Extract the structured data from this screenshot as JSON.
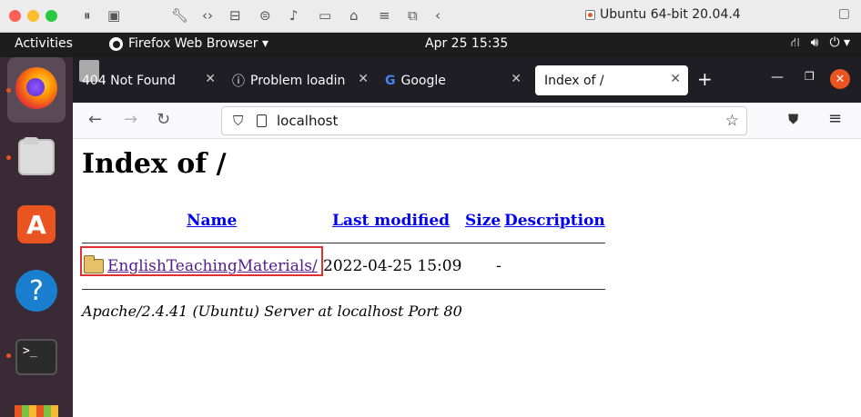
{
  "host": {
    "vm_title": "Ubuntu 64-bit 20.04.4"
  },
  "panel": {
    "activities": "Activities",
    "app_menu": "Firefox Web Browser ▾",
    "clock": "Apr 25  15:35",
    "tray": [
      "network-icon",
      "volume-icon",
      "power-icon"
    ]
  },
  "dock": {
    "items": [
      "firefox",
      "files",
      "ubuntu-software",
      "help",
      "terminal",
      "show-applications"
    ],
    "accent": "#e95420"
  },
  "browser": {
    "tabs": [
      {
        "label": "404 Not Found"
      },
      {
        "label": "Problem loadin"
      },
      {
        "label": "Google"
      },
      {
        "label": "Index of /",
        "active": true
      }
    ],
    "url": "localhost"
  },
  "page": {
    "title": "Index of /",
    "columns": {
      "name": "Name",
      "last_modified": "Last modified",
      "size": "Size",
      "description": "Description"
    },
    "rows": [
      {
        "name": "EnglishTeachingMaterials/",
        "modified": "2022-04-25 15:09",
        "size": "-",
        "description": ""
      }
    ],
    "footer": "Apache/2.4.41 (Ubuntu) Server at localhost Port 80"
  }
}
